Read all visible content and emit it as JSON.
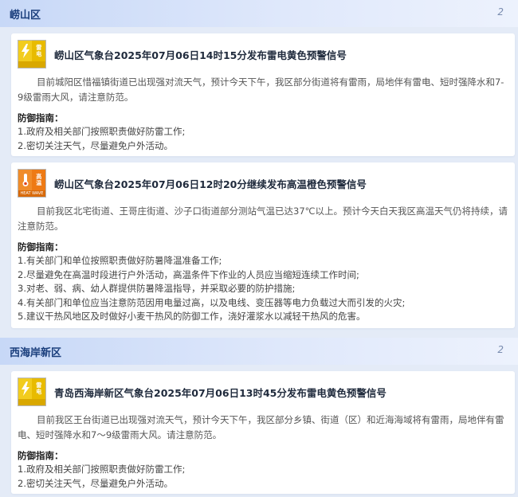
{
  "regions": [
    {
      "name": "崂山区",
      "count": "2",
      "cards": [
        {
          "badge_text": [
            "雷",
            "电"
          ],
          "badge_sub": "",
          "title": "崂山区气象台2025年07月06日14时15分发布雷电黄色预警信号",
          "desc": "目前城阳区惜福镇街道已出现强对流天气，预计今天下午，我区部分街道将有雷雨，局地伴有雷电、短时强降水和7-9级雷雨大风，请注意防范。",
          "guide_title": "防御指南：",
          "guide_items": [
            "1.政府及相关部门按照职责做好防雷工作;",
            "2.密切关注天气，尽量避免户外活动。"
          ]
        },
        {
          "badge_text": [
            "高",
            "温"
          ],
          "badge_sub": "HEAT WAVE",
          "title": "崂山区气象台2025年07月06日12时20分继续发布高温橙色预警信号",
          "desc": "目前我区北宅街道、王哥庄街道、沙子口街道部分测站气温已达37℃以上。预计今天白天我区高温天气仍将持续，请注意防范。",
          "guide_title": "防御指南：",
          "guide_items": [
            "1.有关部门和单位按照职责做好防暑降温准备工作;",
            "2.尽量避免在高温时段进行户外活动，高温条件下作业的人员应当缩短连续工作时间;",
            "3.对老、弱、病、幼人群提供防暑降温指导，并采取必要的防护措施;",
            "4.有关部门和单位应当注意防范因用电量过高，以及电线、变压器等电力负载过大而引发的火灾;",
            "5.建议干热风地区及时做好小麦干热风的防御工作，浇好灌浆水以减轻干热风的危害。"
          ]
        }
      ]
    },
    {
      "name": "西海岸新区",
      "count": "2",
      "cards": [
        {
          "badge_text": [
            "雷",
            "电"
          ],
          "badge_sub": "",
          "title": "青岛西海岸新区气象台2025年07月06日13时45分发布雷电黄色预警信号",
          "desc": "目前我区王台街道已出现强对流天气，预计今天下午，我区部分乡镇、街道（区）和近海海域将有雷雨，局地伴有雷电、短时强降水和7～9级雷雨大风。请注意防范。",
          "guide_title": "防御指南：",
          "guide_items": [
            "1.政府及相关部门按照职责做好防雷工作;",
            "2.密切关注天气，尽量避免户外活动。"
          ]
        }
      ]
    }
  ],
  "icons": {
    "lightning": "lightning-icon",
    "heat": "heat-icon"
  },
  "colors": {
    "yellow": "#f2cc1e",
    "orange": "#f08c2a",
    "header_text": "#1a3e7c"
  }
}
